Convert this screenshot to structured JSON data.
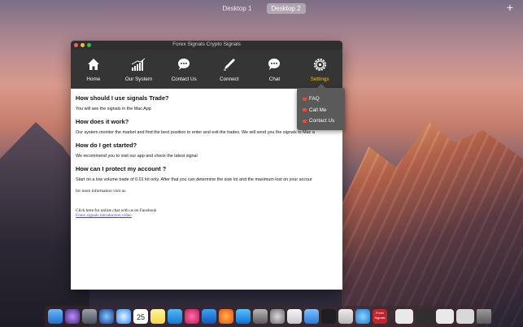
{
  "desktop": {
    "spaces": [
      "Desktop 1",
      "Desktop 2"
    ],
    "active_space": "Desktop 2",
    "add_space_label": "+"
  },
  "window": {
    "title": "Forex Signals Crypto Signals",
    "toolbar": [
      {
        "label": "Home",
        "icon": "home-icon"
      },
      {
        "label": "Our System",
        "icon": "bar-chart-icon"
      },
      {
        "label": "Contact Us",
        "icon": "speech-bubble-icon"
      },
      {
        "label": "Connect",
        "icon": "pen-icon"
      },
      {
        "label": "Chat",
        "icon": "chat-bubble-icon"
      },
      {
        "label": "Settings",
        "icon": "gear-icon"
      }
    ],
    "active_tool": "Settings",
    "active_color": "#f2c200"
  },
  "dropdown": {
    "items": [
      "FAQ",
      "Call Me",
      "Contact Us"
    ]
  },
  "content": {
    "q1": "How should I use signals Trade?",
    "a1": "You will see the signals in the Mac App",
    "q2": "How does it work?",
    "a2": "Our system monitor the market and find the best position to enter and exit the trades. We will send you the signals to Mac a",
    "q3": "How do I get started?",
    "a3": "We recommend you to visit our app and check the latest signal",
    "q4": "How can I protect my account ?",
    "a4": "Start on a low volume trade of  0.01 lot only. After that you can determine the size lot and the maximum lost on your accour",
    "more_info": "for more information visit us.",
    "facebook_line": "Click here for online chat with us on Facebook",
    "video_link": "Forex signals introduction video"
  },
  "dock": {
    "calendar_day": "25",
    "app_label": "Forex Signals"
  }
}
